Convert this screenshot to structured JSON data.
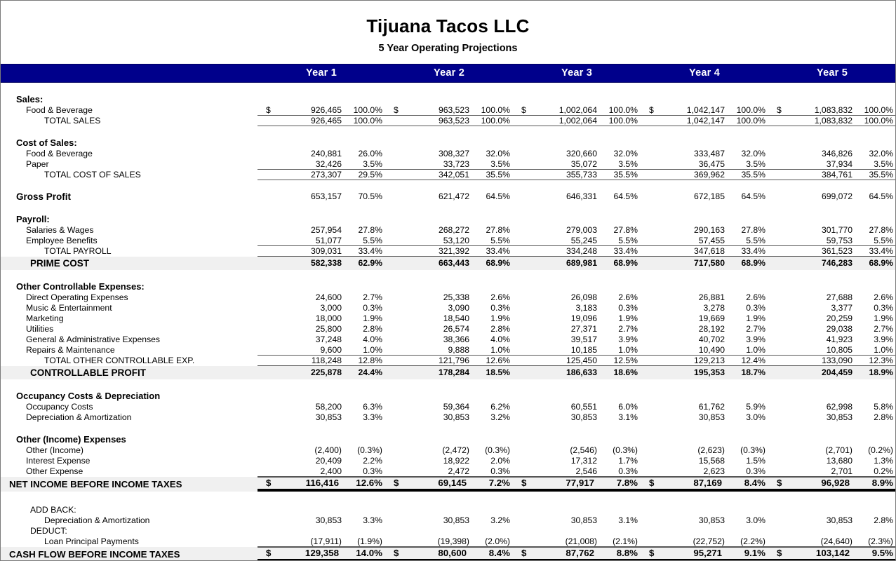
{
  "document": {
    "company": "Tijuana Tacos LLC",
    "subtitle": "5 Year Operating Projections",
    "header_color": "#00008B",
    "shade_color": "#F0F0F0"
  },
  "columns": [
    {
      "label": "Year 1"
    },
    {
      "label": "Year 2"
    },
    {
      "label": "Year 3"
    },
    {
      "label": "Year 4"
    },
    {
      "label": "Year 5"
    }
  ],
  "sections": {
    "sales_head": "Sales:",
    "cost_of_sales_head": "Cost of Sales:",
    "payroll_head": "Payroll:",
    "other_controllable_head": "Other Controllable Expenses:",
    "occupancy_head": "Occupancy Costs & Depreciation",
    "other_income_head": "Other (Income) Expenses",
    "add_back_head": "ADD BACK:",
    "deduct_head": "DEDUCT:"
  },
  "rows": {
    "sales_fb": {
      "label": "Food & Beverage",
      "cur": [
        "$",
        "$",
        "$",
        "$",
        "$"
      ],
      "amt": [
        "926,465",
        "963,523",
        "1,002,064",
        "1,042,147",
        "1,083,832"
      ],
      "pct": [
        "100.0%",
        "100.0%",
        "100.0%",
        "100.0%",
        "100.0%"
      ]
    },
    "total_sales": {
      "label": "TOTAL SALES",
      "amt": [
        "926,465",
        "963,523",
        "1,002,064",
        "1,042,147",
        "1,083,832"
      ],
      "pct": [
        "100.0%",
        "100.0%",
        "100.0%",
        "100.0%",
        "100.0%"
      ]
    },
    "cos_fb": {
      "label": "Food & Beverage",
      "amt": [
        "240,881",
        "308,327",
        "320,660",
        "333,487",
        "346,826"
      ],
      "pct": [
        "26.0%",
        "32.0%",
        "32.0%",
        "32.0%",
        "32.0%"
      ]
    },
    "cos_paper": {
      "label": "Paper",
      "amt": [
        "32,426",
        "33,723",
        "35,072",
        "36,475",
        "37,934"
      ],
      "pct": [
        "3.5%",
        "3.5%",
        "3.5%",
        "3.5%",
        "3.5%"
      ]
    },
    "total_cos": {
      "label": "TOTAL COST OF SALES",
      "amt": [
        "273,307",
        "342,051",
        "355,733",
        "369,962",
        "384,761"
      ],
      "pct": [
        "29.5%",
        "35.5%",
        "35.5%",
        "35.5%",
        "35.5%"
      ]
    },
    "gross_profit": {
      "label": "Gross Profit",
      "amt": [
        "653,157",
        "621,472",
        "646,331",
        "672,185",
        "699,072"
      ],
      "pct": [
        "70.5%",
        "64.5%",
        "64.5%",
        "64.5%",
        "64.5%"
      ]
    },
    "salaries": {
      "label": "Salaries & Wages",
      "amt": [
        "257,954",
        "268,272",
        "279,003",
        "290,163",
        "301,770"
      ],
      "pct": [
        "27.8%",
        "27.8%",
        "27.8%",
        "27.8%",
        "27.8%"
      ]
    },
    "benefits": {
      "label": "Employee Benefits",
      "amt": [
        "51,077",
        "53,120",
        "55,245",
        "57,455",
        "59,753"
      ],
      "pct": [
        "5.5%",
        "5.5%",
        "5.5%",
        "5.5%",
        "5.5%"
      ]
    },
    "total_payroll": {
      "label": "TOTAL PAYROLL",
      "amt": [
        "309,031",
        "321,392",
        "334,248",
        "347,618",
        "361,523"
      ],
      "pct": [
        "33.4%",
        "33.4%",
        "33.4%",
        "33.4%",
        "33.4%"
      ]
    },
    "prime_cost": {
      "label": "PRIME COST",
      "amt": [
        "582,338",
        "663,443",
        "689,981",
        "717,580",
        "746,283"
      ],
      "pct": [
        "62.9%",
        "68.9%",
        "68.9%",
        "68.9%",
        "68.9%"
      ]
    },
    "direct_op": {
      "label": "Direct Operating Expenses",
      "amt": [
        "24,600",
        "25,338",
        "26,098",
        "26,881",
        "27,688"
      ],
      "pct": [
        "2.7%",
        "2.6%",
        "2.6%",
        "2.6%",
        "2.6%"
      ]
    },
    "music": {
      "label": "Music & Entertainment",
      "amt": [
        "3,000",
        "3,090",
        "3,183",
        "3,278",
        "3,377"
      ],
      "pct": [
        "0.3%",
        "0.3%",
        "0.3%",
        "0.3%",
        "0.3%"
      ]
    },
    "marketing": {
      "label": "Marketing",
      "amt": [
        "18,000",
        "18,540",
        "19,096",
        "19,669",
        "20,259"
      ],
      "pct": [
        "1.9%",
        "1.9%",
        "1.9%",
        "1.9%",
        "1.9%"
      ]
    },
    "utilities": {
      "label": "Utilities",
      "amt": [
        "25,800",
        "26,574",
        "27,371",
        "28,192",
        "29,038"
      ],
      "pct": [
        "2.8%",
        "2.8%",
        "2.7%",
        "2.7%",
        "2.7%"
      ]
    },
    "gna": {
      "label": "General & Administrative Expenses",
      "amt": [
        "37,248",
        "38,366",
        "39,517",
        "40,702",
        "41,923"
      ],
      "pct": [
        "4.0%",
        "4.0%",
        "3.9%",
        "3.9%",
        "3.9%"
      ]
    },
    "repairs": {
      "label": "Repairs & Maintenance",
      "amt": [
        "9,600",
        "9,888",
        "10,185",
        "10,490",
        "10,805"
      ],
      "pct": [
        "1.0%",
        "1.0%",
        "1.0%",
        "1.0%",
        "1.0%"
      ]
    },
    "total_other_controllable": {
      "label": "TOTAL OTHER CONTROLLABLE EXP.",
      "amt": [
        "118,248",
        "121,796",
        "125,450",
        "129,213",
        "133,090"
      ],
      "pct": [
        "12.8%",
        "12.6%",
        "12.5%",
        "12.4%",
        "12.3%"
      ]
    },
    "controllable_profit": {
      "label": "CONTROLLABLE PROFIT",
      "amt": [
        "225,878",
        "178,284",
        "186,633",
        "195,353",
        "204,459"
      ],
      "pct": [
        "24.4%",
        "18.5%",
        "18.6%",
        "18.7%",
        "18.9%"
      ]
    },
    "occupancy": {
      "label": "Occupancy Costs",
      "amt": [
        "58,200",
        "59,364",
        "60,551",
        "61,762",
        "62,998"
      ],
      "pct": [
        "6.3%",
        "6.2%",
        "6.0%",
        "5.9%",
        "5.8%"
      ]
    },
    "depreciation": {
      "label": "Depreciation & Amortization",
      "amt": [
        "30,853",
        "30,853",
        "30,853",
        "30,853",
        "30,853"
      ],
      "pct": [
        "3.3%",
        "3.2%",
        "3.1%",
        "3.0%",
        "2.8%"
      ]
    },
    "other_income": {
      "label": "Other (Income)",
      "amt": [
        "(2,400)",
        "(2,472)",
        "(2,546)",
        "(2,623)",
        "(2,701)"
      ],
      "pct": [
        "(0.3%)",
        "(0.3%)",
        "(0.3%)",
        "(0.3%)",
        "(0.2%)"
      ]
    },
    "interest_expense": {
      "label": "Interest Expense",
      "amt": [
        "20,409",
        "18,922",
        "17,312",
        "15,568",
        "13,680"
      ],
      "pct": [
        "2.2%",
        "2.0%",
        "1.7%",
        "1.5%",
        "1.3%"
      ]
    },
    "other_expense": {
      "label": "Other Expense",
      "amt": [
        "2,400",
        "2,472",
        "2,546",
        "2,623",
        "2,701"
      ],
      "pct": [
        "0.3%",
        "0.3%",
        "0.3%",
        "0.3%",
        "0.2%"
      ]
    },
    "net_income": {
      "label": "NET INCOME BEFORE INCOME TAXES",
      "cur": [
        "$",
        "$",
        "$",
        "$",
        "$"
      ],
      "amt": [
        "116,416",
        "69,145",
        "77,917",
        "87,169",
        "96,928"
      ],
      "pct": [
        "12.6%",
        "7.2%",
        "7.8%",
        "8.4%",
        "8.9%"
      ]
    },
    "addback_depreciation": {
      "label": "Depreciation & Amortization",
      "amt": [
        "30,853",
        "30,853",
        "30,853",
        "30,853",
        "30,853"
      ],
      "pct": [
        "3.3%",
        "3.2%",
        "3.1%",
        "3.0%",
        "2.8%"
      ]
    },
    "loan_principal": {
      "label": "Loan Principal Payments",
      "amt": [
        "(17,911)",
        "(19,398)",
        "(21,008)",
        "(22,752)",
        "(24,640)"
      ],
      "pct": [
        "(1.9%)",
        "(2.0%)",
        "(2.1%)",
        "(2.2%)",
        "(2.3%)"
      ]
    },
    "cash_flow": {
      "label": "CASH FLOW BEFORE INCOME TAXES",
      "cur": [
        "$",
        "$",
        "$",
        "$",
        "$"
      ],
      "amt": [
        "129,358",
        "80,600",
        "87,762",
        "95,271",
        "103,142"
      ],
      "pct": [
        "14.0%",
        "8.4%",
        "8.8%",
        "9.1%",
        "9.5%"
      ]
    }
  }
}
